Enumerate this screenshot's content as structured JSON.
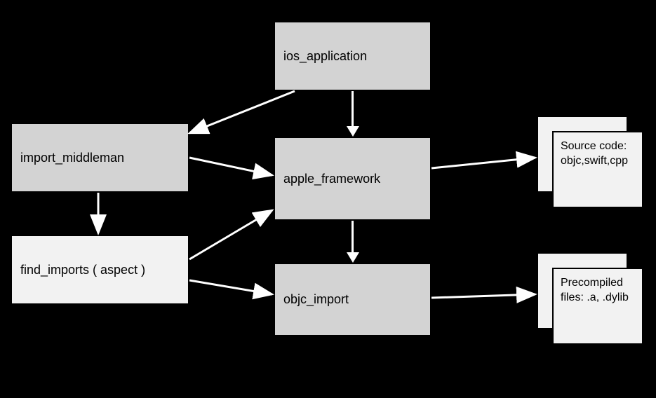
{
  "nodes": {
    "import_middleman": "import_middleman",
    "find_imports": "find_imports ( aspect )",
    "ios_application": "ios_application",
    "apple_framework": "apple_framework",
    "objc_import": "objc_import",
    "source_code": "Source code: objc,swift,cpp",
    "precompiled": "Precompiled files: .a, .dylib"
  }
}
